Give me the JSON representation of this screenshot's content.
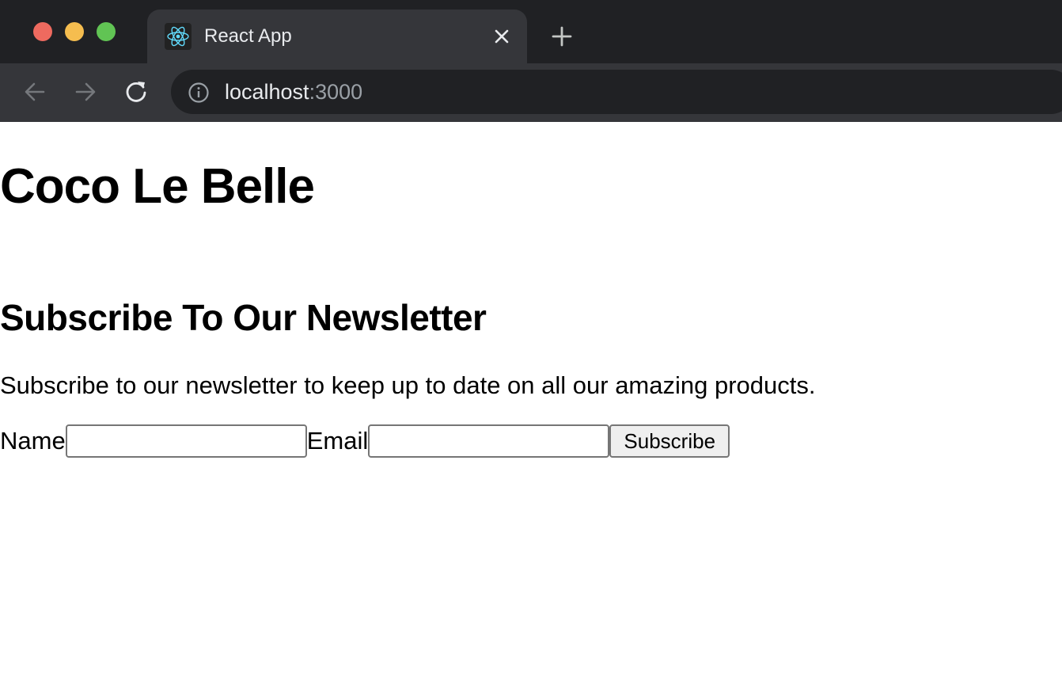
{
  "browser": {
    "tab": {
      "title": "React App",
      "favicon": "react-logo-icon"
    },
    "url": {
      "host": "localhost",
      "port": ":3000"
    },
    "icons": {
      "back": "arrow-left-icon",
      "forward": "arrow-right-icon",
      "reload": "reload-icon",
      "info": "info-icon",
      "close": "close-icon",
      "new_tab": "plus-icon"
    },
    "colors": {
      "close_red": "#ee6a5f",
      "minimize_yellow": "#f5bd4f",
      "maximize_green": "#61c454",
      "react_accent": "#61dafb"
    }
  },
  "page": {
    "title": "Coco Le Belle",
    "newsletter": {
      "heading": "Subscribe To Our Newsletter",
      "description": "Subscribe to our newsletter to keep up to date on all our amazing products.",
      "name_label": "Name",
      "name_value": "",
      "email_label": "Email",
      "email_value": "",
      "submit_label": "Subscribe"
    }
  }
}
